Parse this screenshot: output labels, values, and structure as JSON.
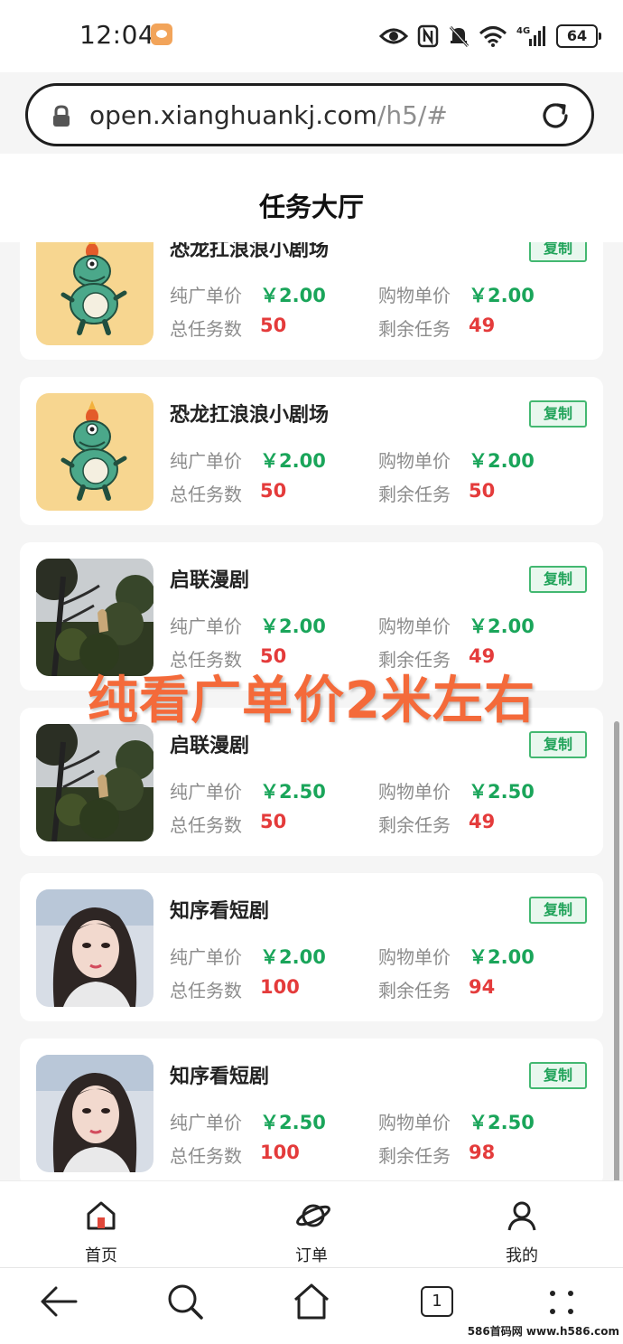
{
  "status_bar": {
    "time": "12:04",
    "battery": "64",
    "network": "4G"
  },
  "browser": {
    "url_host": "open.xianghuankj.com",
    "url_path": "/h5/#"
  },
  "page": {
    "title": "任务大厅"
  },
  "labels": {
    "pure_ad_price": "纯广单价",
    "shopping_price": "购物单价",
    "total_tasks": "总任务数",
    "remaining_tasks": "剩余任务",
    "copy": "复制"
  },
  "tasks": [
    {
      "title": "恐龙扛浪浪小剧场",
      "thumb": "dinosaur-mascot",
      "pure_ad_price": "￥2.00",
      "shopping_price": "￥2.00",
      "total": "50",
      "remaining": "49"
    },
    {
      "title": "恐龙扛浪浪小剧场",
      "thumb": "dinosaur-mascot",
      "pure_ad_price": "￥2.00",
      "shopping_price": "￥2.00",
      "total": "50",
      "remaining": "50"
    },
    {
      "title": "启联漫剧",
      "thumb": "forest-photo",
      "pure_ad_price": "￥2.00",
      "shopping_price": "￥2.00",
      "total": "50",
      "remaining": "49"
    },
    {
      "title": "启联漫剧",
      "thumb": "forest-photo",
      "pure_ad_price": "￥2.50",
      "shopping_price": "￥2.50",
      "total": "50",
      "remaining": "49"
    },
    {
      "title": "知序看短剧",
      "thumb": "portrait-photo",
      "pure_ad_price": "￥2.00",
      "shopping_price": "￥2.00",
      "total": "100",
      "remaining": "94"
    },
    {
      "title": "知序看短剧",
      "thumb": "portrait-photo",
      "pure_ad_price": "￥2.50",
      "shopping_price": "￥2.50",
      "total": "100",
      "remaining": "98"
    }
  ],
  "overlay_caption": "纯看广单价2米左右",
  "tabbar": {
    "items": [
      {
        "label": "首页",
        "icon": "home-icon"
      },
      {
        "label": "订单",
        "icon": "planet-icon"
      },
      {
        "label": "我的",
        "icon": "user-icon"
      }
    ]
  },
  "navbar": {
    "tab_count": "1"
  },
  "watermark": "586首码网 www.h586.com",
  "colors": {
    "green": "#1aa55a",
    "red": "#e43b3b",
    "overlay": "#f46a3a",
    "home_accent": "#e0473a"
  }
}
